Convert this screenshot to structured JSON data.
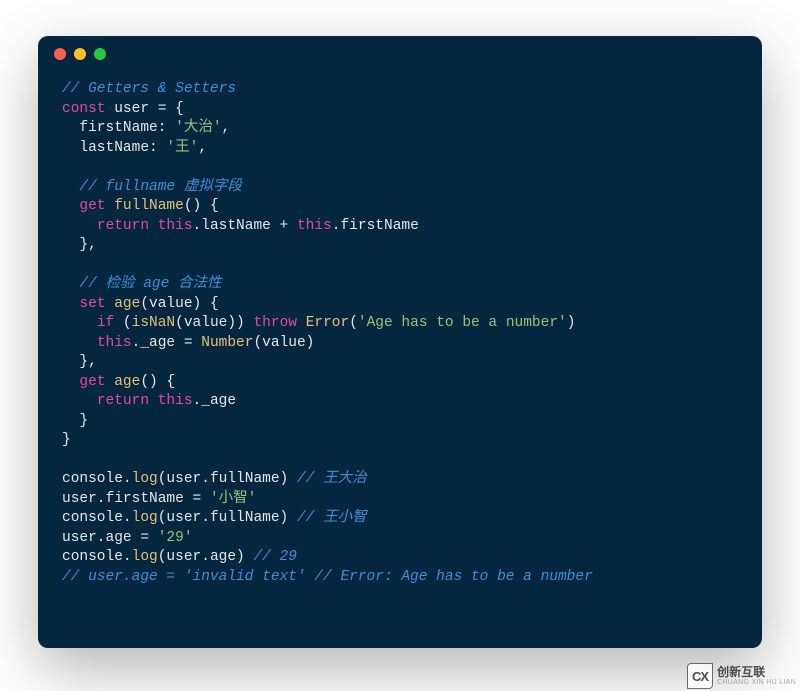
{
  "code": {
    "l1": "// Getters & Setters",
    "l2a": "const",
    "l2b": " user = {",
    "l3a": "  firstName: ",
    "l3b": "'大治'",
    "l3c": ",",
    "l4a": "  lastName: ",
    "l4b": "'王'",
    "l4c": ",",
    "l5": "",
    "l6": "  // fullname 虚拟字段",
    "l7a": "  ",
    "l7b": "get",
    "l7c": " ",
    "l7d": "fullName",
    "l7e": "() {",
    "l8a": "    ",
    "l8b": "return",
    "l8c": " ",
    "l8d": "this",
    "l8e": ".lastName + ",
    "l8f": "this",
    "l8g": ".firstName",
    "l9": "  },",
    "l10": "",
    "l11": "  // 检验 age 合法性",
    "l12a": "  ",
    "l12b": "set",
    "l12c": " ",
    "l12d": "age",
    "l12e": "(value) {",
    "l13a": "    ",
    "l13b": "if",
    "l13c": " (",
    "l13d": "isNaN",
    "l13e": "(value)) ",
    "l13f": "throw",
    "l13g": " ",
    "l13h": "Error",
    "l13i": "(",
    "l13j": "'Age has to be a number'",
    "l13k": ")",
    "l14a": "    ",
    "l14b": "this",
    "l14c": "._age = ",
    "l14d": "Number",
    "l14e": "(value)",
    "l15": "  },",
    "l16a": "  ",
    "l16b": "get",
    "l16c": " ",
    "l16d": "age",
    "l16e": "() {",
    "l17a": "    ",
    "l17b": "return",
    "l17c": " ",
    "l17d": "this",
    "l17e": "._age",
    "l18": "  }",
    "l19": "}",
    "l20": "",
    "l21a": "console.",
    "l21b": "log",
    "l21c": "(user.fullName) ",
    "l21d": "// 王大治",
    "l22a": "user.firstName = ",
    "l22b": "'小智'",
    "l23a": "console.",
    "l23b": "log",
    "l23c": "(user.fullName) ",
    "l23d": "// 王小智",
    "l24a": "user.age = ",
    "l24b": "'29'",
    "l25a": "console.",
    "l25b": "log",
    "l25c": "(user.age) ",
    "l25d": "// 29",
    "l26": "// user.age = 'invalid text' // Error: Age has to be a number"
  },
  "watermark": {
    "icon": "CX",
    "cn": "创新互联",
    "en": "CHUANG XIN HU LIAN"
  }
}
